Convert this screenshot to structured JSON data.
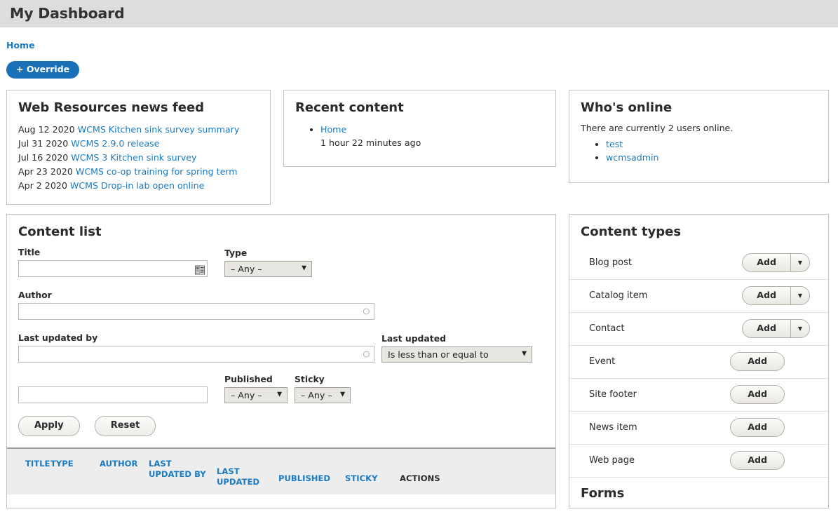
{
  "header": {
    "title": "My Dashboard"
  },
  "breadcrumb": {
    "home": "Home"
  },
  "actions": {
    "override": "+ Override"
  },
  "news_panel": {
    "title": "Web Resources news feed",
    "items": [
      {
        "date": "Aug 12 2020",
        "link": "WCMS Kitchen sink survey summary"
      },
      {
        "date": "Jul 31 2020",
        "link": "WCMS 2.9.0 release"
      },
      {
        "date": "Jul 16 2020",
        "link": "WCMS 3 Kitchen sink survey"
      },
      {
        "date": "Apr 23 2020",
        "link": "WCMS co-op training for spring term"
      },
      {
        "date": "Apr 2 2020",
        "link": "WCMS Drop-in lab open online"
      }
    ]
  },
  "recent_panel": {
    "title": "Recent content",
    "items": [
      {
        "link": "Home",
        "time": "1 hour 22 minutes ago"
      }
    ]
  },
  "online_panel": {
    "title": "Who's online",
    "summary": "There are currently 2 users online.",
    "users": [
      "test",
      "wcmsadmin"
    ]
  },
  "content_list": {
    "title": "Content list",
    "fields": {
      "title_label": "Title",
      "title_value": "",
      "title_icon": "address-book-icon",
      "type_label": "Type",
      "type_value": "– Any –",
      "author_label": "Author",
      "author_value": "",
      "last_updated_by_label": "Last updated by",
      "last_updated_by_value": "",
      "last_updated_label": "Last updated",
      "last_updated_value": "Is less than or equal to",
      "last_updated_date_value": "",
      "published_label": "Published",
      "published_value": "– Any –",
      "sticky_label": "Sticky",
      "sticky_value": "– Any –"
    },
    "buttons": {
      "apply": "Apply",
      "reset": "Reset"
    },
    "table": {
      "columns": [
        {
          "label": "Title",
          "link": true
        },
        {
          "label": "Type",
          "link": true
        },
        {
          "label": "Author",
          "link": true
        },
        {
          "label": "Last updated by",
          "link": true
        },
        {
          "label": "Last updated",
          "link": true
        },
        {
          "label": "Published",
          "link": true
        },
        {
          "label": "Sticky",
          "link": true
        },
        {
          "label": "Actions",
          "link": false
        }
      ]
    }
  },
  "content_types": {
    "title": "Content types",
    "forms_title": "Forms",
    "add_label": "Add",
    "rows": [
      {
        "label": "Blog post",
        "split": true
      },
      {
        "label": "Catalog item",
        "split": true
      },
      {
        "label": "Contact",
        "split": true
      },
      {
        "label": "Event",
        "split": false
      },
      {
        "label": "Site footer",
        "split": false
      },
      {
        "label": "News item",
        "split": false
      },
      {
        "label": "Web page",
        "split": false
      }
    ]
  },
  "colors": {
    "link": "#1b7ac2",
    "button_primary": "#1b71b8",
    "header_bg": "#dddddd",
    "table_header_bg": "#ededed"
  }
}
